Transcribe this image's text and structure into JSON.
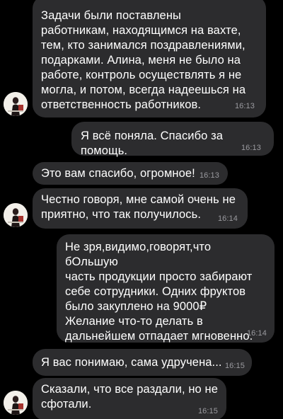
{
  "messages": [
    {
      "text": "Задачи были поставлены\nработникам, находящимся на вахте,\nтем, кто занимался поздравлениями,\nподарками. Алина, меня не было на\nработе, контроль осуществлять я не\nмогла, и потом, всегда надеешься на\nответственность работников.",
      "time": "16:13",
      "direction": "incoming"
    },
    {
      "text": "Я всё поняла. Спасибо за помощь.",
      "time": "16:13",
      "direction": "outgoing"
    },
    {
      "text": "Это вам спасибо, огромное!",
      "time": "16:13",
      "direction": "incoming"
    },
    {
      "text": "Честно говоря, мне самой очень не\nприятно, что так получилось.",
      "time": "16:14",
      "direction": "incoming"
    },
    {
      "text": "Не зря,видимо,говорят,что бОльшую\nчасть продукции просто забирают\nсебе сотрудники. Одних фруктов\nбыло закуплено на 9000₽\nЖелание что-то делать в\nдальнейшем отпадает мгновенно.",
      "time": "16:14",
      "direction": "outgoing"
    },
    {
      "text": "Я вас понимаю, сама удручена...",
      "time": "16:15",
      "direction": "incoming"
    },
    {
      "text": "Сказали, что все раздали, но не\nсфотали.",
      "time": "16:15",
      "direction": "incoming"
    }
  ],
  "colors": {
    "background": "#000000",
    "bubble": "#2c2c2e",
    "text": "#ffffff",
    "timestamp": "#9a9a9f"
  },
  "icons": {
    "avatar": "contact-avatar-photo"
  }
}
